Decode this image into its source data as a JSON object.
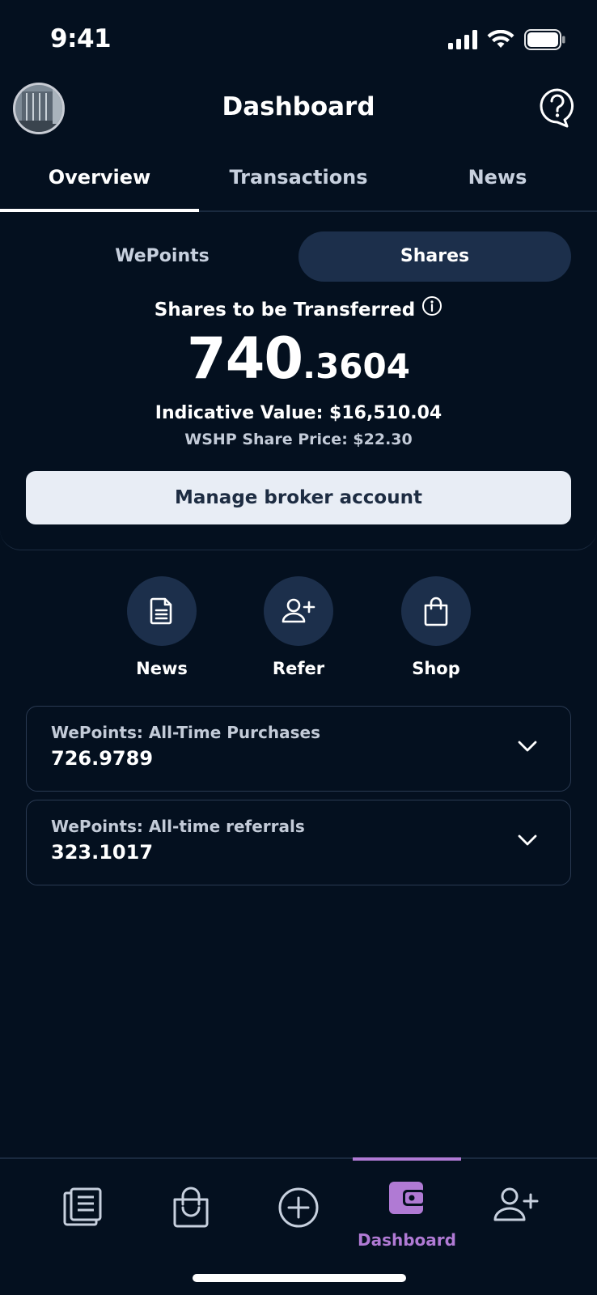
{
  "status_bar": {
    "time": "9:41"
  },
  "header": {
    "title": "Dashboard"
  },
  "top_tabs": [
    {
      "label": "Overview",
      "active": true
    },
    {
      "label": "Transactions",
      "active": false
    },
    {
      "label": "News",
      "active": false
    }
  ],
  "segment": [
    {
      "label": "WePoints",
      "active": false
    },
    {
      "label": "Shares",
      "active": true
    }
  ],
  "shares": {
    "label": "Shares to be Transferred",
    "amount_int": "740",
    "amount_dec": ".3604",
    "indicative_value": "Indicative Value: $16,510.04",
    "share_price": "WSHP Share Price: $22.30",
    "broker_button": "Manage broker account"
  },
  "quick_actions": [
    {
      "label": "News",
      "icon": "document-icon"
    },
    {
      "label": "Refer",
      "icon": "add-user-icon"
    },
    {
      "label": "Shop",
      "icon": "shopping-bag-icon"
    }
  ],
  "accordions": [
    {
      "title": "WePoints: All-Time Purchases",
      "value": "726.9789"
    },
    {
      "title": "WePoints: All-time referrals",
      "value": "323.1017"
    }
  ],
  "bottom_nav": [
    {
      "label": "",
      "icon": "news-feed-icon",
      "active": false
    },
    {
      "label": "",
      "icon": "shopping-bag-icon",
      "active": false
    },
    {
      "label": "",
      "icon": "plus-circle-icon",
      "active": false
    },
    {
      "label": "Dashboard",
      "icon": "wallet-icon",
      "active": true
    },
    {
      "label": "",
      "icon": "add-user-icon",
      "active": false
    }
  ],
  "colors": {
    "background": "#04101f",
    "surface": "#1c2f4b",
    "accent": "#b07ad4",
    "button_light": "#e8edf5"
  }
}
